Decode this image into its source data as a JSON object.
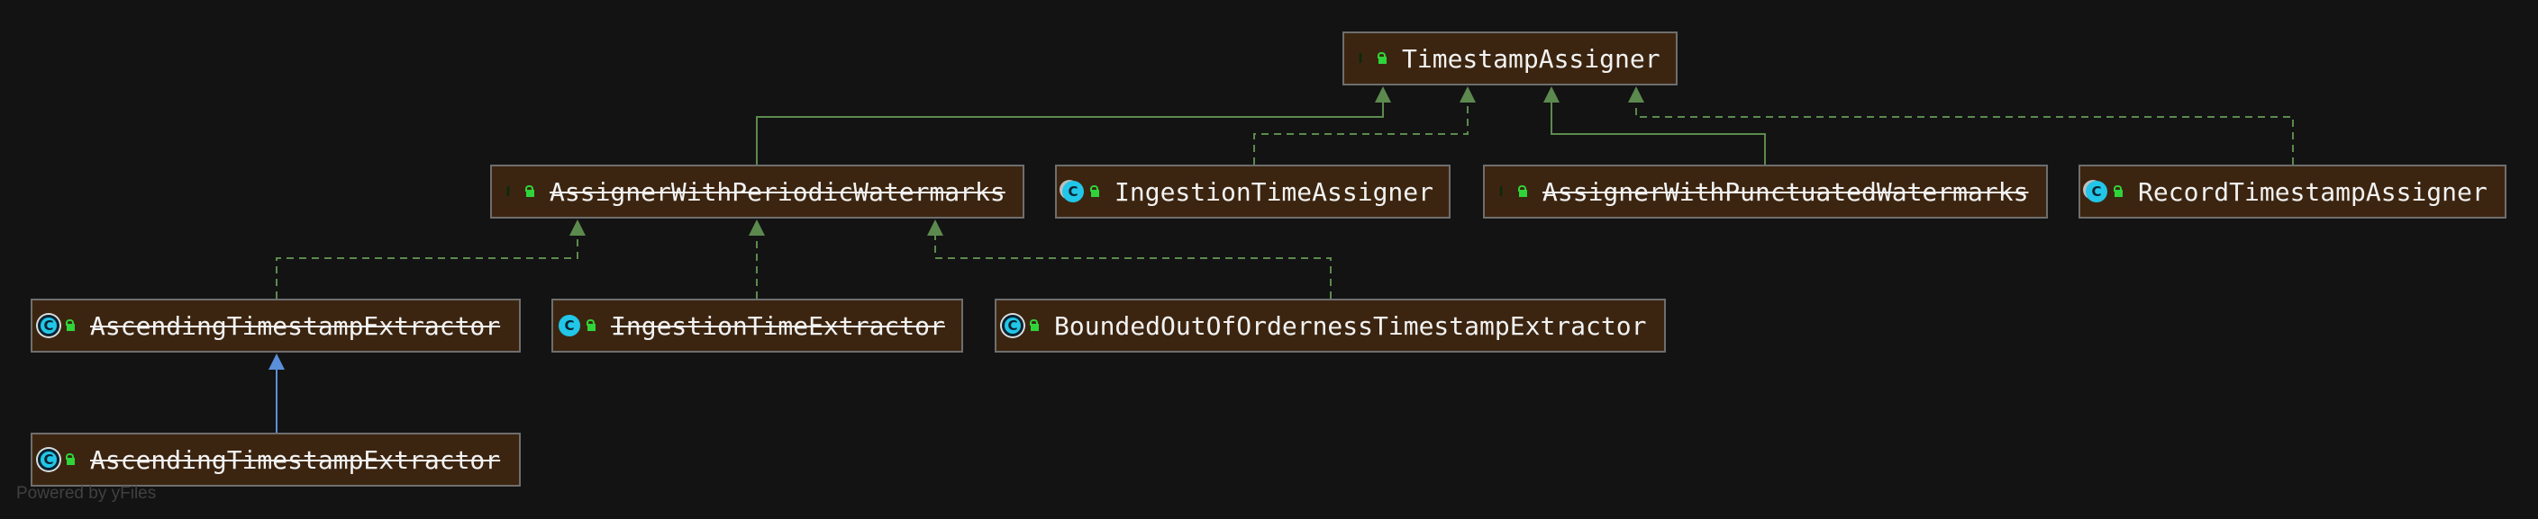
{
  "footer": "Powered by yFiles",
  "colors": {
    "background": "#131313",
    "node_fill": "#3c2510",
    "node_border": "#6e6e6e",
    "implements_edge": "#5c8a4e",
    "extends_edge": "#5b8fd9",
    "interface_badge": "#28d12e",
    "class_badge": "#22c6e8"
  },
  "nodes": [
    {
      "id": "timestamp-assigner",
      "label": "TimestampAssigner",
      "kind": "interface",
      "kind_letter": "I",
      "deprecated": false
    },
    {
      "id": "assigner-with-periodic-watermarks",
      "label": "AssignerWithPeriodicWatermarks",
      "kind": "interface",
      "kind_letter": "I",
      "deprecated": true
    },
    {
      "id": "ingestion-time-assigner",
      "label": "IngestionTimeAssigner",
      "kind": "final-class",
      "kind_letter": "C",
      "deprecated": false
    },
    {
      "id": "assigner-with-punctuated-watermarks",
      "label": "AssignerWithPunctuatedWatermarks",
      "kind": "interface",
      "kind_letter": "I",
      "deprecated": true
    },
    {
      "id": "record-timestamp-assigner",
      "label": "RecordTimestampAssigner",
      "kind": "final-class",
      "kind_letter": "C",
      "deprecated": false
    },
    {
      "id": "ascending-timestamp-extractor-api",
      "label": "AscendingTimestampExtractor",
      "kind": "abstract-class",
      "kind_letter": "C",
      "deprecated": true
    },
    {
      "id": "ingestion-time-extractor",
      "label": "IngestionTimeExtractor",
      "kind": "class",
      "kind_letter": "C",
      "deprecated": true
    },
    {
      "id": "bounded-out-of-orderness-timestamp-extractor",
      "label": "BoundedOutOfOrdernessTimestampExtractor",
      "kind": "abstract-class",
      "kind_letter": "C",
      "deprecated": false
    },
    {
      "id": "ascending-timestamp-extractor-legacy",
      "label": "AscendingTimestampExtractor",
      "kind": "abstract-class",
      "kind_letter": "C",
      "deprecated": true
    }
  ],
  "edges": [
    {
      "from": "assigner-with-periodic-watermarks",
      "to": "timestamp-assigner",
      "type": "extends"
    },
    {
      "from": "ingestion-time-assigner",
      "to": "timestamp-assigner",
      "type": "implements"
    },
    {
      "from": "assigner-with-punctuated-watermarks",
      "to": "timestamp-assigner",
      "type": "extends"
    },
    {
      "from": "record-timestamp-assigner",
      "to": "timestamp-assigner",
      "type": "implements"
    },
    {
      "from": "ascending-timestamp-extractor-api",
      "to": "assigner-with-periodic-watermarks",
      "type": "implements"
    },
    {
      "from": "ingestion-time-extractor",
      "to": "assigner-with-periodic-watermarks",
      "type": "implements"
    },
    {
      "from": "bounded-out-of-orderness-timestamp-extractor",
      "to": "assigner-with-periodic-watermarks",
      "type": "implements"
    },
    {
      "from": "ascending-timestamp-extractor-legacy",
      "to": "ascending-timestamp-extractor-api",
      "type": "class-extends"
    }
  ]
}
